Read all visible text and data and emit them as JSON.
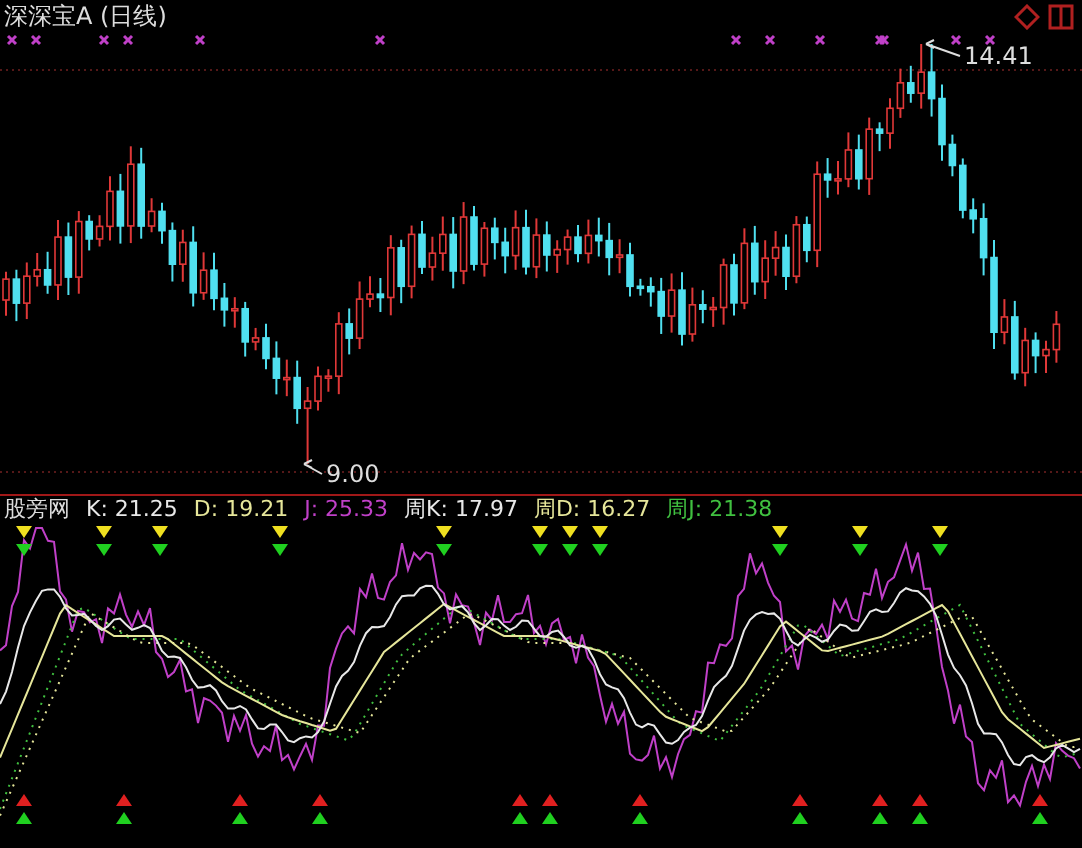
{
  "chart_title": "深深宝A (日线)",
  "price_labels": [
    {
      "kind": "high",
      "text": "14.41"
    },
    {
      "kind": "low",
      "text": "9.00"
    }
  ],
  "indicator": {
    "name": "股旁网",
    "legend": [
      {
        "text": "K: 21.25",
        "color": "#e8e8e8"
      },
      {
        "text": "D: 19.21",
        "color": "#e6e69a"
      },
      {
        "text": "J: 25.33",
        "color": "#c040c8"
      },
      {
        "text": "周K: 17.97",
        "color": "#e8e8e8"
      },
      {
        "text": "周D: 16.27",
        "color": "#e6e69a"
      },
      {
        "text": "周J: 21.38",
        "color": "#40c040"
      }
    ]
  }
}
